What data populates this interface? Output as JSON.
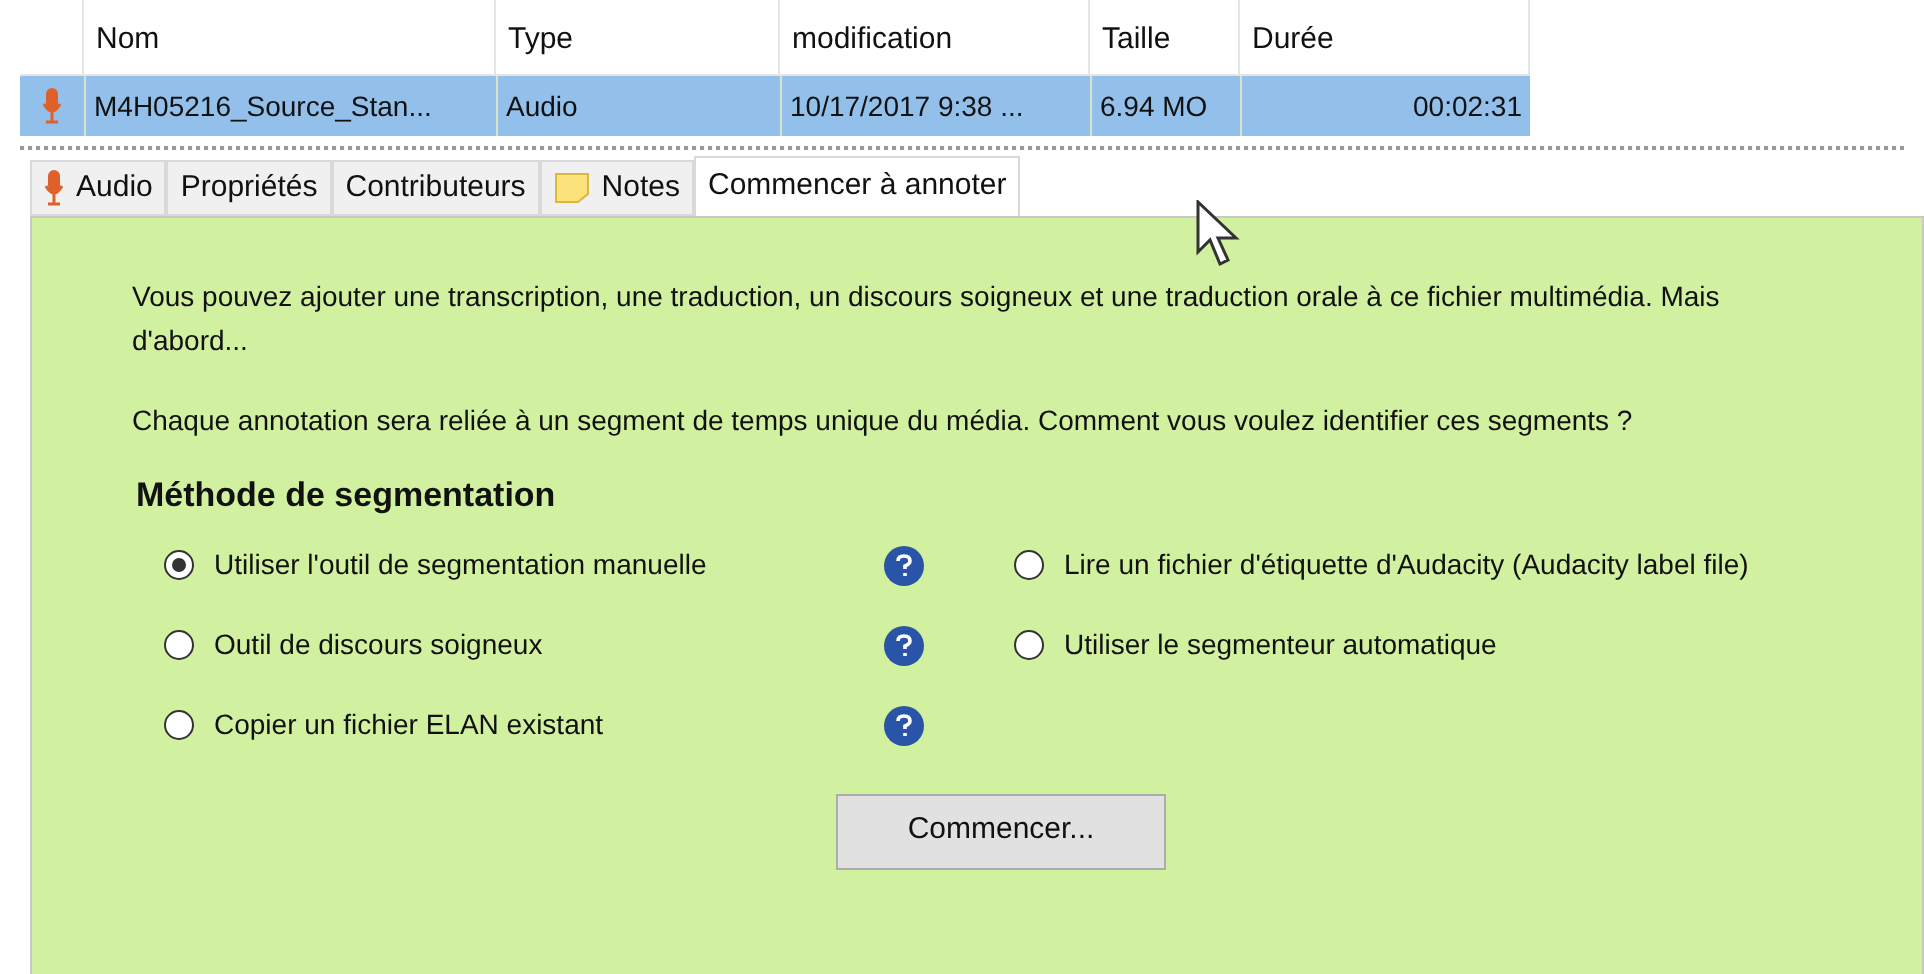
{
  "table": {
    "columns": [
      {
        "label": "Nom"
      },
      {
        "label": "Type"
      },
      {
        "label": "modification"
      },
      {
        "label": "Taille"
      },
      {
        "label": "Durée"
      }
    ],
    "rows": [
      {
        "selected": true,
        "cells": [
          "M4H05216_Source_Stan...",
          "Audio",
          "10/17/2017 9:38 ...",
          "6.94 MO",
          "00:02:31"
        ]
      }
    ]
  },
  "tabs": [
    {
      "label": "Audio",
      "kind": "mic",
      "selected": false
    },
    {
      "label": "Propriétés",
      "kind": "plain",
      "selected": false
    },
    {
      "label": "Contributeurs",
      "kind": "plain",
      "selected": false
    },
    {
      "label": "Notes",
      "kind": "note",
      "selected": false
    },
    {
      "label": "Commencer à annoter",
      "kind": "plain",
      "selected": true
    }
  ],
  "panel": {
    "intro": "Vous pouvez ajouter une transcription, une traduction, un discours soigneux et une traduction orale à ce fichier multimédia. Mais d'abord...",
    "question": "Chaque annotation sera reliée à un segment de temps unique du média. Comment vous voulez identifier ces segments ?",
    "heading": "Méthode de segmentation",
    "options_left": [
      {
        "label": "Utiliser l'outil de segmentation manuelle",
        "selected": true,
        "help": true
      },
      {
        "label": "Outil de discours soigneux",
        "selected": false,
        "help": true
      },
      {
        "label": "Copier un fichier ELAN existant",
        "selected": false,
        "help": true
      }
    ],
    "options_right": [
      {
        "label": "Lire un fichier d'étiquette d'Audacity (Audacity label file)",
        "selected": false,
        "help": false
      },
      {
        "label": "Utiliser le segmenteur automatique",
        "selected": false,
        "help": false
      }
    ],
    "button": "Commencer..."
  }
}
